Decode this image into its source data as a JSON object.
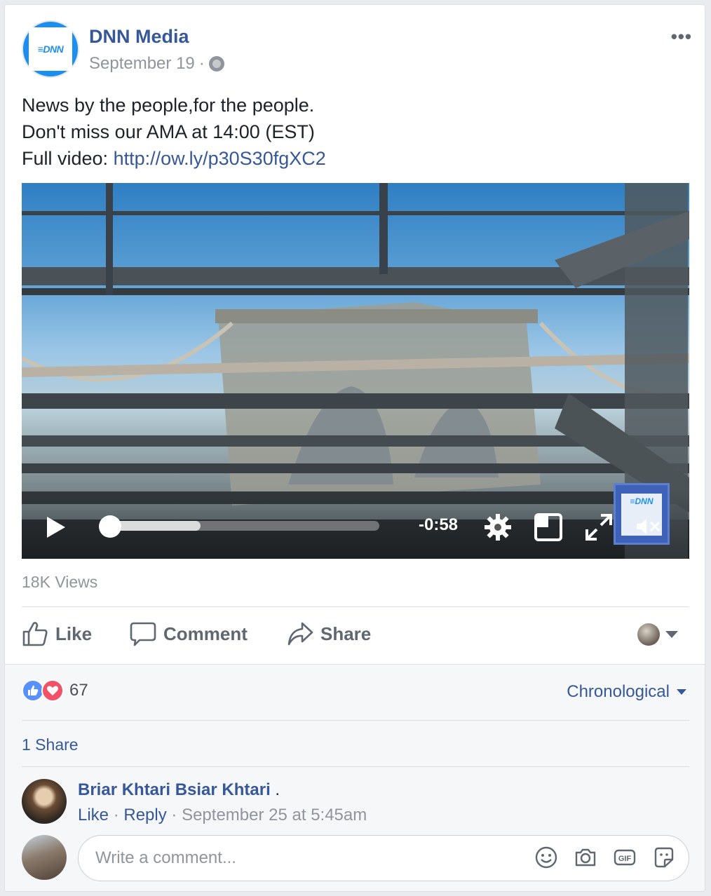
{
  "post": {
    "page_name": "DNN Media",
    "avatar_text": "≡DNN",
    "date": "September 19",
    "separator": "·",
    "text_line1": "News by the people,for the people.",
    "text_line2": "Don't miss our AMA at 14:00 (EST)",
    "text_line3_prefix": "Full video: ",
    "link": "http://ow.ly/p30S30fgXC2",
    "more_label": "•••"
  },
  "video": {
    "time_remaining": "-0:58",
    "thumb_text": "≡DNN",
    "progress": 0.0,
    "buffered": 0.35
  },
  "stats": {
    "views": "18K Views"
  },
  "actions": {
    "like": "Like",
    "comment": "Comment",
    "share": "Share"
  },
  "reactions": {
    "count": "67",
    "sort": "Chronological"
  },
  "shares": {
    "label": "1 Share"
  },
  "comment": {
    "author": "Briar Khtari Bsiar Khtari",
    "trailing": ".",
    "like": "Like",
    "reply": "Reply",
    "sep": "·",
    "timestamp": "September 25 at 5:45am"
  },
  "composer": {
    "placeholder": "Write a comment..."
  },
  "colors": {
    "link": "#365899",
    "muted": "#90949c",
    "like_blue": "#5890ff",
    "love_red": "#f25268"
  }
}
